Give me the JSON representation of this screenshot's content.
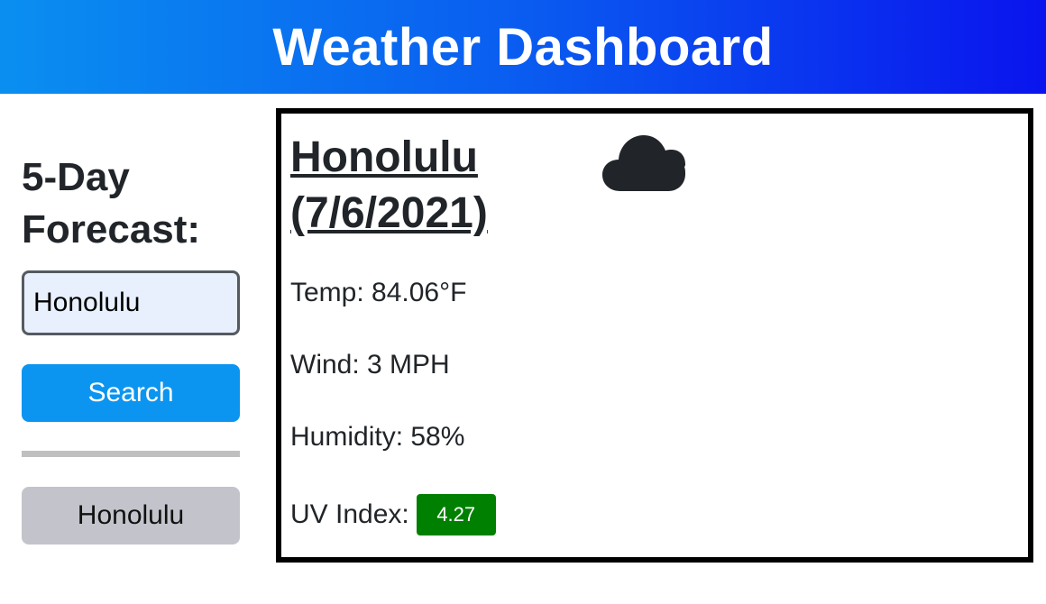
{
  "header": {
    "title": "Weather Dashboard"
  },
  "sidebar": {
    "heading": "5-Day Forecast:",
    "search_input_value": "Honolulu",
    "search_button_label": "Search",
    "history": [
      {
        "label": "Honolulu"
      }
    ]
  },
  "current": {
    "city_date": "Honolulu (7/6/2021)",
    "icon": "cloud-icon",
    "temp": "Temp: 84.06°F",
    "wind": "Wind: 3 MPH",
    "humidity": "Humidity: 58%",
    "uv_label": "UV Index:",
    "uv_value": "4.27"
  },
  "colors": {
    "header_gradient_start": "#0a8ff0",
    "header_gradient_end": "#0a14ee",
    "search_button": "#0b95f0",
    "history_button": "#c3c4cb",
    "uv_badge": "#008000"
  }
}
